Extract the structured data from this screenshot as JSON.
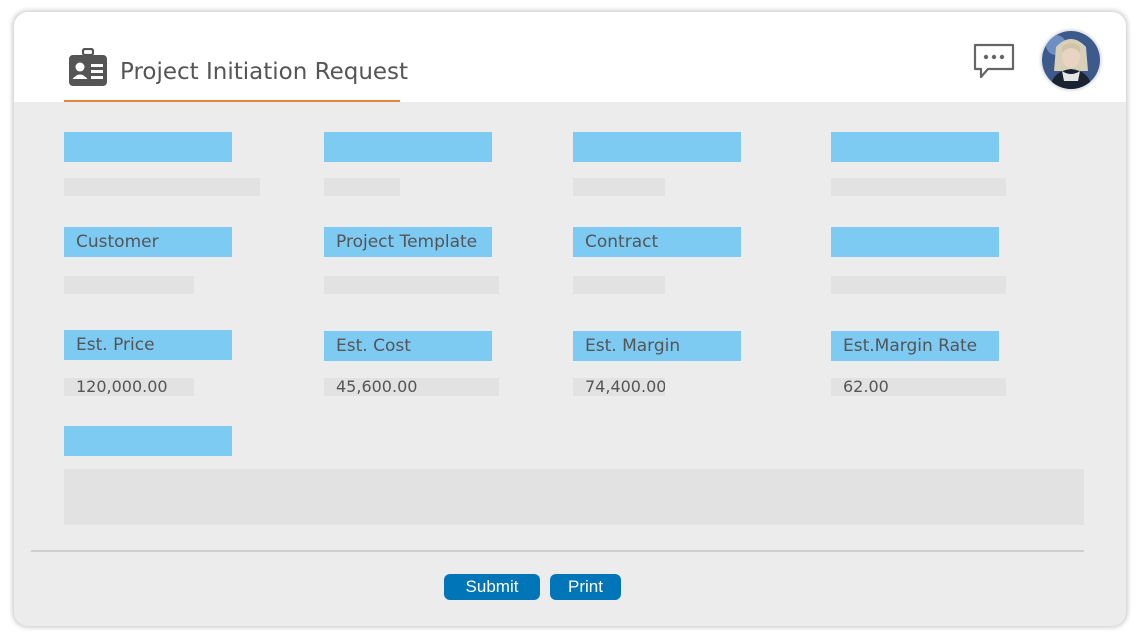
{
  "header": {
    "title": "Project Initiation Request",
    "title_icon": "id-badge-icon",
    "chat_icon": "chat-bubble-icon",
    "avatar": "user-avatar"
  },
  "fields": {
    "row1": [
      {
        "label": "",
        "value": ""
      },
      {
        "label": "",
        "value": ""
      },
      {
        "label": "",
        "value": ""
      },
      {
        "label": "",
        "value": ""
      }
    ],
    "row2": [
      {
        "label": "Customer",
        "value": ""
      },
      {
        "label": "Project Template",
        "value": ""
      },
      {
        "label": "Contract",
        "value": ""
      },
      {
        "label": "",
        "value": ""
      }
    ],
    "row3": [
      {
        "label": "Est. Price",
        "value": "120,000.00"
      },
      {
        "label": "Est. Cost",
        "value": "45,600.00"
      },
      {
        "label": "Est. Margin",
        "value": "74,400.00"
      },
      {
        "label": "Est.Margin Rate",
        "value": "62.00"
      }
    ],
    "row4": [
      {
        "label": "",
        "value": ""
      }
    ]
  },
  "actions": {
    "submit_label": "Submit",
    "print_label": "Print"
  },
  "colors": {
    "label_bg": "#7dcaf2",
    "accent_underline": "#e8843d",
    "button_bg": "#0075b8",
    "field_bg": "#e2e2e2",
    "panel_bg": "#ececec"
  }
}
